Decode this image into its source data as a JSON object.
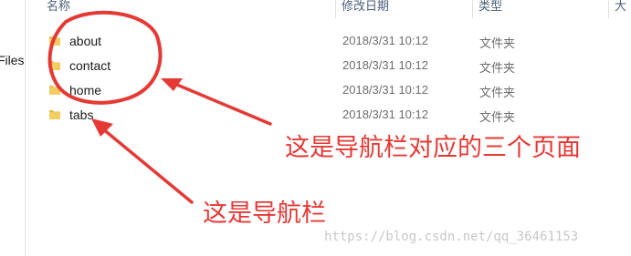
{
  "sidebar": {
    "partial_label": "Files"
  },
  "columns": {
    "name": "名称",
    "date_modified": "修改日期",
    "type": "类型",
    "size": "大"
  },
  "rows": [
    {
      "name": "about",
      "date": "2018/3/31 10:12",
      "type": "文件夹",
      "icon": "folder-icon"
    },
    {
      "name": "contact",
      "date": "2018/3/31 10:12",
      "type": "文件夹",
      "icon": "folder-icon"
    },
    {
      "name": "home",
      "date": "2018/3/31 10:12",
      "type": "文件夹",
      "icon": "folder-icon"
    },
    {
      "name": "tabs",
      "date": "2018/3/31 10:12",
      "type": "文件夹",
      "icon": "folder-icon"
    }
  ],
  "annotations": {
    "pages_note": "这是导航栏对应的三个页面",
    "nav_note": "这是导航栏"
  },
  "watermark": "https://blog.csdn.net/qq_36461153",
  "colors": {
    "annotation": "#e53935",
    "folder": "#e8b84a",
    "header_text": "#4c607a"
  }
}
